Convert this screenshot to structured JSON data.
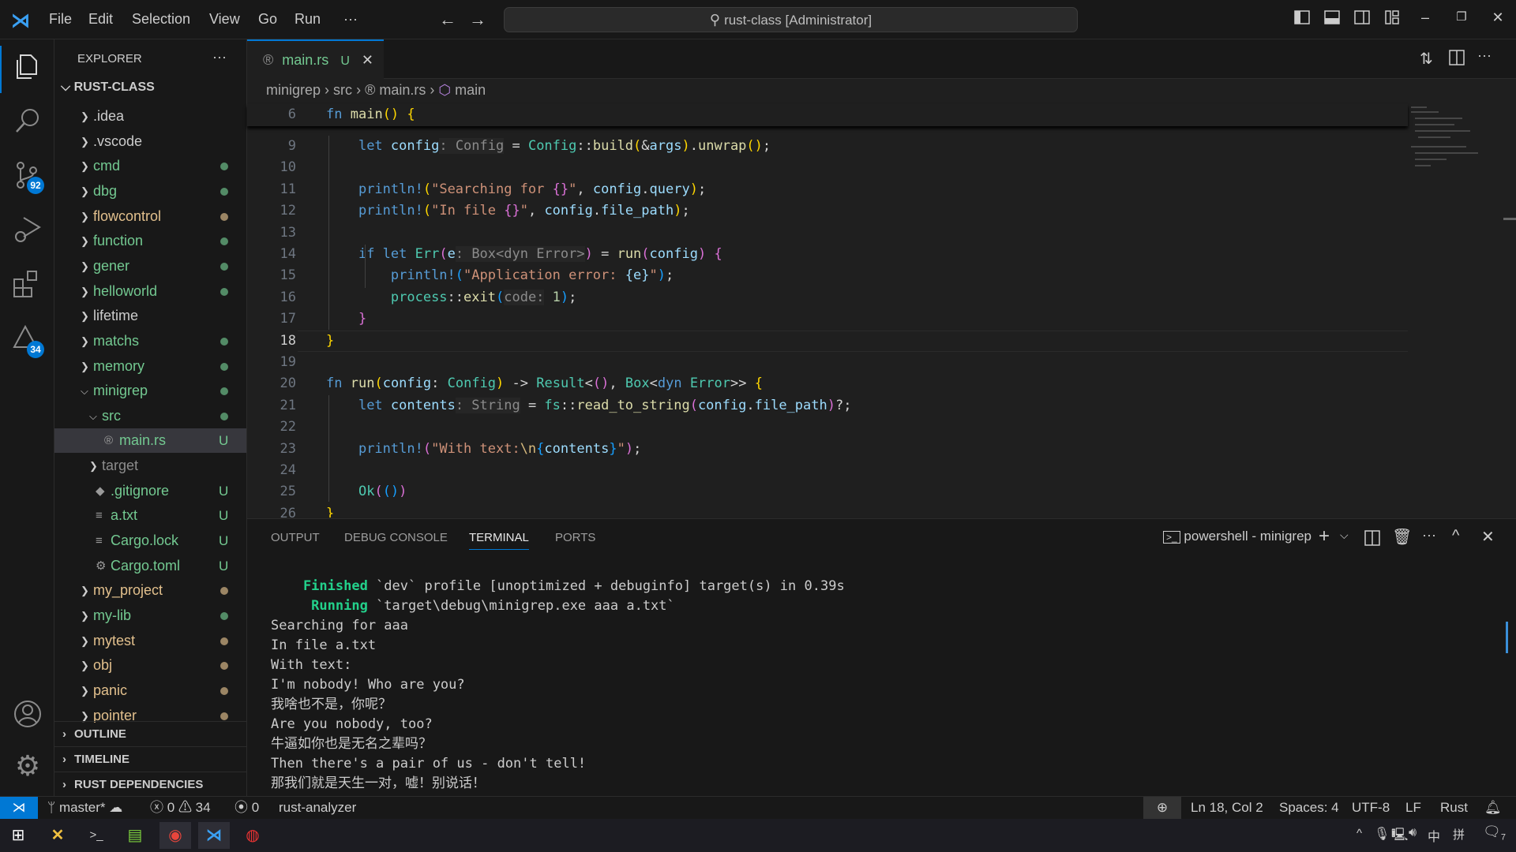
{
  "title": {
    "menu": [
      "File",
      "Edit",
      "Selection",
      "View",
      "Go",
      "Run",
      "···"
    ],
    "search": "rust-class [Administrator]"
  },
  "activity": {
    "scm_badge": "92",
    "problems_badge": "34"
  },
  "explorer": {
    "header": "EXPLORER",
    "more": "···",
    "root": "RUST-CLASS",
    "items": [
      {
        "name": ".idea",
        "depth": 1,
        "kind": "folder",
        "status": "none"
      },
      {
        "name": ".vscode",
        "depth": 1,
        "kind": "folder",
        "status": "none"
      },
      {
        "name": "cmd",
        "depth": 1,
        "kind": "folder",
        "status": "untracked"
      },
      {
        "name": "dbg",
        "depth": 1,
        "kind": "folder",
        "status": "untracked"
      },
      {
        "name": "flowcontrol",
        "depth": 1,
        "kind": "folder",
        "status": "modified"
      },
      {
        "name": "function",
        "depth": 1,
        "kind": "folder",
        "status": "untracked"
      },
      {
        "name": "gener",
        "depth": 1,
        "kind": "folder",
        "status": "untracked"
      },
      {
        "name": "helloworld",
        "depth": 1,
        "kind": "folder",
        "status": "untracked"
      },
      {
        "name": "lifetime",
        "depth": 1,
        "kind": "folder",
        "status": "none"
      },
      {
        "name": "matchs",
        "depth": 1,
        "kind": "folder",
        "status": "untracked"
      },
      {
        "name": "memory",
        "depth": 1,
        "kind": "folder",
        "status": "untracked"
      },
      {
        "name": "minigrep",
        "depth": 1,
        "kind": "folder-open",
        "status": "untracked"
      },
      {
        "name": "src",
        "depth": 2,
        "kind": "folder-open",
        "status": "untracked"
      },
      {
        "name": "main.rs",
        "depth": 3,
        "kind": "rust-file",
        "status": "U",
        "selected": true
      },
      {
        "name": "target",
        "depth": 2,
        "kind": "folder",
        "status": "ignored"
      },
      {
        "name": ".gitignore",
        "depth": 2,
        "kind": "git-file",
        "status": "U"
      },
      {
        "name": "a.txt",
        "depth": 2,
        "kind": "text-file",
        "status": "U"
      },
      {
        "name": "Cargo.lock",
        "depth": 2,
        "kind": "text-file",
        "status": "U"
      },
      {
        "name": "Cargo.toml",
        "depth": 2,
        "kind": "gear-file",
        "status": "U"
      },
      {
        "name": "my_project",
        "depth": 1,
        "kind": "folder",
        "status": "modified"
      },
      {
        "name": "my-lib",
        "depth": 1,
        "kind": "folder",
        "status": "untracked"
      },
      {
        "name": "mytest",
        "depth": 1,
        "kind": "folder",
        "status": "modified"
      },
      {
        "name": "obj",
        "depth": 1,
        "kind": "folder",
        "status": "modified"
      },
      {
        "name": "panic",
        "depth": 1,
        "kind": "folder",
        "status": "modified"
      },
      {
        "name": "pointer",
        "depth": 1,
        "kind": "folder",
        "status": "modified"
      }
    ],
    "sections": [
      "OUTLINE",
      "TIMELINE",
      "RUST DEPENDENCIES"
    ]
  },
  "colors": {
    "untracked": "#73c991",
    "modified": "#e2c08d",
    "ignored": "#8c8c8c",
    "none": "#cccccc",
    "accent": "#0078d4"
  },
  "tab": {
    "label": "main.rs",
    "badge": "U"
  },
  "breadcrumb": [
    "minigrep",
    "src",
    "main.rs",
    "main"
  ],
  "editor": {
    "sticky": {
      "num": "6",
      "tokens": [
        [
          "k",
          "fn"
        ],
        [
          "p",
          " "
        ],
        [
          "f",
          "main"
        ],
        [
          "b1",
          "()"
        ],
        [
          "p",
          " "
        ],
        [
          "b1",
          "{"
        ]
      ]
    },
    "current_line": "18",
    "lines": [
      {
        "num": "9",
        "tokens": [
          [
            "p",
            "    "
          ],
          [
            "k",
            "let"
          ],
          [
            "p",
            " "
          ],
          [
            "v",
            "config"
          ],
          [
            "h",
            ": Config"
          ],
          [
            "p",
            " = "
          ],
          [
            "t",
            "Config"
          ],
          [
            "p",
            "::"
          ],
          [
            "f",
            "build"
          ],
          [
            "b1",
            "("
          ],
          [
            "p",
            "&"
          ],
          [
            "v",
            "args"
          ],
          [
            "b1",
            ")"
          ],
          [
            "p",
            "."
          ],
          [
            "f",
            "unwrap"
          ],
          [
            "b1",
            "()"
          ],
          [
            "p",
            ";"
          ]
        ]
      },
      {
        "num": "10",
        "tokens": []
      },
      {
        "num": "11",
        "tokens": [
          [
            "p",
            "    "
          ],
          [
            "m",
            "println!"
          ],
          [
            "b1",
            "("
          ],
          [
            "s",
            "\"Searching for "
          ],
          [
            "b2",
            "{}"
          ],
          [
            "s",
            "\""
          ],
          [
            "p",
            ", "
          ],
          [
            "v",
            "config"
          ],
          [
            "p",
            "."
          ],
          [
            "v",
            "query"
          ],
          [
            "b1",
            ")"
          ],
          [
            "p",
            ";"
          ]
        ]
      },
      {
        "num": "12",
        "tokens": [
          [
            "p",
            "    "
          ],
          [
            "m",
            "println!"
          ],
          [
            "b1",
            "("
          ],
          [
            "s",
            "\"In file "
          ],
          [
            "b2",
            "{}"
          ],
          [
            "s",
            "\""
          ],
          [
            "p",
            ", "
          ],
          [
            "v",
            "config"
          ],
          [
            "p",
            "."
          ],
          [
            "v",
            "file_path"
          ],
          [
            "b1",
            ")"
          ],
          [
            "p",
            ";"
          ]
        ]
      },
      {
        "num": "13",
        "tokens": []
      },
      {
        "num": "14",
        "tokens": [
          [
            "p",
            "    "
          ],
          [
            "k",
            "if let"
          ],
          [
            "p",
            " "
          ],
          [
            "t",
            "Err"
          ],
          [
            "b2",
            "("
          ],
          [
            "v",
            "e"
          ],
          [
            "h",
            ": Box<dyn Error>"
          ],
          [
            "b2",
            ")"
          ],
          [
            "p",
            " = "
          ],
          [
            "f",
            "run"
          ],
          [
            "b2",
            "("
          ],
          [
            "v",
            "config"
          ],
          [
            "b2",
            ")"
          ],
          [
            "p",
            " "
          ],
          [
            "b2",
            "{"
          ]
        ]
      },
      {
        "num": "15",
        "tokens": [
          [
            "p",
            "        "
          ],
          [
            "m",
            "println!"
          ],
          [
            "b3",
            "("
          ],
          [
            "s",
            "\"Application error: "
          ],
          [
            "v",
            "{e}"
          ],
          [
            "s",
            "\""
          ],
          [
            "b3",
            ")"
          ],
          [
            "p",
            ";"
          ]
        ]
      },
      {
        "num": "16",
        "tokens": [
          [
            "p",
            "        "
          ],
          [
            "t",
            "process"
          ],
          [
            "p",
            "::"
          ],
          [
            "f",
            "exit"
          ],
          [
            "b3",
            "("
          ],
          [
            "h",
            "code:"
          ],
          [
            "p",
            " "
          ],
          [
            "n",
            "1"
          ],
          [
            "b3",
            ")"
          ],
          [
            "p",
            ";"
          ]
        ]
      },
      {
        "num": "17",
        "tokens": [
          [
            "p",
            "    "
          ],
          [
            "b2",
            "}"
          ]
        ]
      },
      {
        "num": "18",
        "tokens": [
          [
            "b1",
            "}"
          ]
        ]
      },
      {
        "num": "19",
        "tokens": []
      },
      {
        "num": "20",
        "tokens": [
          [
            "k",
            "fn"
          ],
          [
            "p",
            " "
          ],
          [
            "f",
            "run"
          ],
          [
            "b1",
            "("
          ],
          [
            "v",
            "config"
          ],
          [
            "p",
            ": "
          ],
          [
            "t",
            "Config"
          ],
          [
            "b1",
            ")"
          ],
          [
            "p",
            " -> "
          ],
          [
            "t",
            "Result"
          ],
          [
            "p",
            "<"
          ],
          [
            "b2",
            "()"
          ],
          [
            "p",
            ", "
          ],
          [
            "t",
            "Box"
          ],
          [
            "p",
            "<"
          ],
          [
            "k",
            "dyn"
          ],
          [
            "p",
            " "
          ],
          [
            "t",
            "Error"
          ],
          [
            "p",
            ">> "
          ],
          [
            "b1",
            "{"
          ]
        ]
      },
      {
        "num": "21",
        "tokens": [
          [
            "p",
            "    "
          ],
          [
            "k",
            "let"
          ],
          [
            "p",
            " "
          ],
          [
            "v",
            "contents"
          ],
          [
            "h",
            ": String"
          ],
          [
            "p",
            " = "
          ],
          [
            "t",
            "fs"
          ],
          [
            "p",
            "::"
          ],
          [
            "f",
            "read_to_string"
          ],
          [
            "b2",
            "("
          ],
          [
            "v",
            "config"
          ],
          [
            "p",
            "."
          ],
          [
            "v",
            "file_path"
          ],
          [
            "b2",
            ")"
          ],
          [
            "p",
            "?;"
          ]
        ]
      },
      {
        "num": "22",
        "tokens": []
      },
      {
        "num": "23",
        "tokens": [
          [
            "p",
            "    "
          ],
          [
            "m",
            "println!"
          ],
          [
            "b2",
            "("
          ],
          [
            "s",
            "\"With text:"
          ],
          [
            "e",
            "\\n"
          ],
          [
            "b3",
            "{"
          ],
          [
            "v",
            "contents"
          ],
          [
            "b3",
            "}"
          ],
          [
            "s",
            "\""
          ],
          [
            "b2",
            ")"
          ],
          [
            "p",
            ";"
          ]
        ]
      },
      {
        "num": "24",
        "tokens": []
      },
      {
        "num": "25",
        "tokens": [
          [
            "p",
            "    "
          ],
          [
            "t",
            "Ok"
          ],
          [
            "b2",
            "("
          ],
          [
            "b3",
            "()"
          ],
          [
            "b2",
            ")"
          ]
        ]
      },
      {
        "num": "26",
        "tokens": [
          [
            "b1",
            "}"
          ]
        ]
      }
    ]
  },
  "panel": {
    "tabs": [
      "OUTPUT",
      "DEBUG CONSOLE",
      "TERMINAL",
      "PORTS"
    ],
    "active": "TERMINAL",
    "terminal_name": "powershell - minigrep",
    "lines": [
      {
        "prefix": "    Finished",
        "text": " `dev` profile [unoptimized + debuginfo] target(s) in 0.39s"
      },
      {
        "prefix": "     Running",
        "text": " `target\\debug\\minigrep.exe aaa a.txt`"
      },
      {
        "prefix": "",
        "text": "Searching for aaa"
      },
      {
        "prefix": "",
        "text": "In file a.txt"
      },
      {
        "prefix": "",
        "text": "With text:"
      },
      {
        "prefix": "",
        "text": "I'm nobody! Who are you?"
      },
      {
        "prefix": "",
        "text": "我啥也不是，你呢？"
      },
      {
        "prefix": "",
        "text": "Are you nobody, too?"
      },
      {
        "prefix": "",
        "text": "牛逼如你也是无名之辈吗？"
      },
      {
        "prefix": "",
        "text": "Then there's a pair of us - don't tell!"
      },
      {
        "prefix": "",
        "text": "那我们就是天生一对，嘘！别说话！"
      }
    ]
  },
  "status": {
    "branch": "master*",
    "errors": "0",
    "warnings": "34",
    "ports": "0",
    "analyzer": "rust-analyzer",
    "position": "Ln 18, Col 2",
    "spaces": "Spaces: 4",
    "encoding": "UTF-8",
    "eol": "LF",
    "language": "Rust"
  },
  "taskbar": {
    "tray_ime": "中",
    "tray_layout": "拼",
    "notifications": "7"
  }
}
